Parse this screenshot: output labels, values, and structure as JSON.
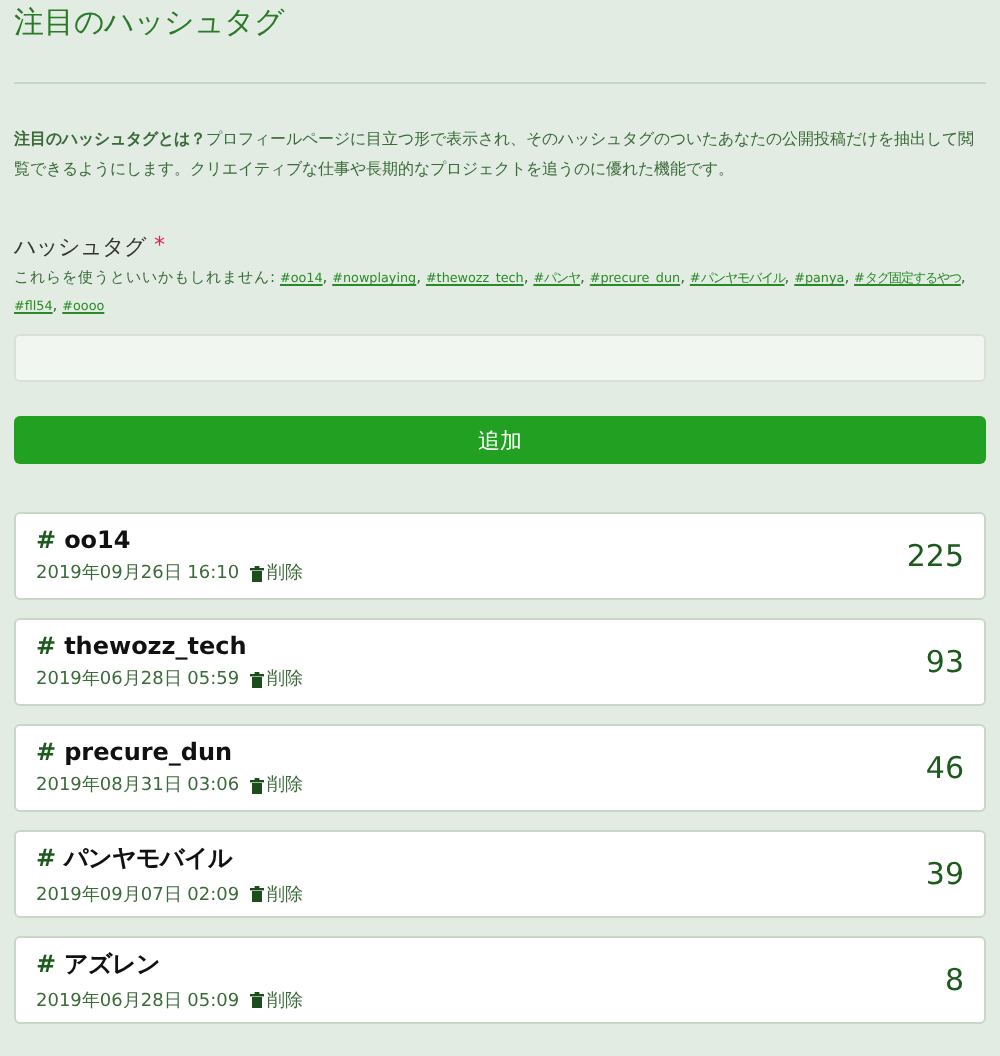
{
  "page": {
    "title": "注目のハッシュタグ"
  },
  "description": {
    "lead": "注目のハッシュタグとは？",
    "body": "プロフィールページに目立つ形で表示され、そのハッシュタグのついたあなたの公開投稿だけを抽出して閲覧できるようにします。クリエイティブな仕事や長期的なプロジェクトを追うのに優れた機能です。"
  },
  "form": {
    "label": "ハッシュタグ",
    "required_mark": "*",
    "suggestions_label": "これらを使うといいかもしれません:",
    "separator": ",",
    "suggestions": [
      {
        "text": "#oo14"
      },
      {
        "text": "#nowplaying"
      },
      {
        "text": "#thewozz_tech"
      },
      {
        "text": "#パンヤ"
      },
      {
        "text": "#precure_dun"
      },
      {
        "text": "#パンヤモバイル"
      },
      {
        "text": "#panya"
      },
      {
        "text": "#タグ固定するやつ"
      },
      {
        "text": "#fll54"
      },
      {
        "text": "#oooo"
      }
    ],
    "submit": "追加"
  },
  "tags": [
    {
      "hash": "#",
      "name": "oo14",
      "date": "2019年09月26日 16:10",
      "delete": "削除",
      "count": "225"
    },
    {
      "hash": "#",
      "name": "thewozz_tech",
      "date": "2019年06月28日 05:59",
      "delete": "削除",
      "count": "93"
    },
    {
      "hash": "#",
      "name": "precure_dun",
      "date": "2019年08月31日 03:06",
      "delete": "削除",
      "count": "46"
    },
    {
      "hash": "#",
      "name": "パンヤモバイル",
      "date": "2019年09月07日 02:09",
      "delete": "削除",
      "count": "39"
    },
    {
      "hash": "#",
      "name": "アズレン",
      "date": "2019年06月28日 05:09",
      "delete": "削除",
      "count": "8"
    }
  ]
}
